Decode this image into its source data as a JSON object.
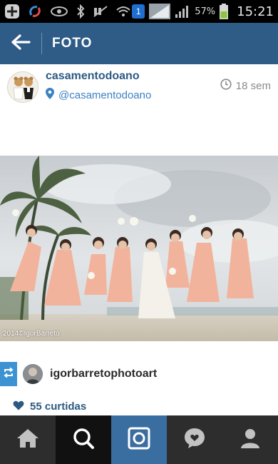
{
  "status_bar": {
    "battery_percent": "57%",
    "time": "15:21",
    "notification_badge": "1"
  },
  "header": {
    "title": "FOTO"
  },
  "post": {
    "username": "casamentodoano",
    "location": "@casamentodoano",
    "timestamp": "18 sem",
    "photo_credit": "2014©IgorBarreto"
  },
  "credit": {
    "username": "igorbarretophotoart"
  },
  "likes": {
    "text": "55 curtidas"
  },
  "colors": {
    "header_bg": "#2e5c87",
    "accent": "#3d93d2",
    "nav_bg": "#2d2d2d",
    "nav_active_camera": "#3b6ea0"
  },
  "icons": {
    "back": "arrow-left-icon",
    "location": "location-pin-icon",
    "time": "clock-icon",
    "repost": "repost-icon",
    "likes": "heart-icon",
    "nav": [
      "home-icon",
      "search-icon",
      "camera-icon",
      "activity-icon",
      "profile-icon"
    ]
  }
}
